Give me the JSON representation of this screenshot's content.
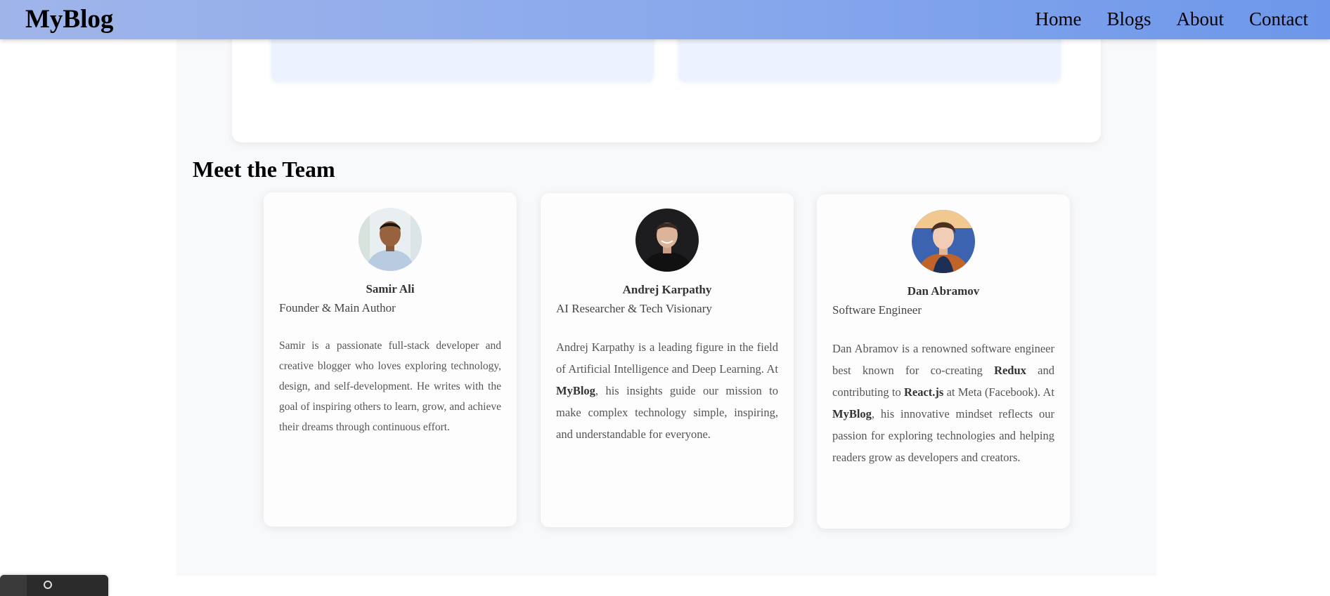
{
  "navbar": {
    "brand": "MyBlog",
    "links": [
      "Home",
      "Blogs",
      "About",
      "Contact"
    ],
    "gradient_start": "#9fb5ea",
    "gradient_end": "#6d97ea"
  },
  "team_section": {
    "title": "Meet the Team",
    "members": [
      {
        "name": "Samir Ali",
        "role": "Founder & Main Author",
        "avatar": "samir-ali-photo",
        "bio": "Samir is a passionate full-stack developer and creative blogger who loves exploring technology, design, and self-development. He writes with the goal of inspiring others to learn, grow, and achieve their dreams through continuous effort."
      },
      {
        "name": "Andrej Karpathy",
        "role": "AI Researcher & Tech Visionary",
        "avatar": "andrej-karpathy-photo",
        "bio_parts": [
          "Andrej Karpathy is a leading figure in the field of Artificial Intelligence and Deep Learning. At ",
          "MyBlog",
          ", his insights guide our mission to make complex technology simple, inspiring, and understandable for everyone."
        ]
      },
      {
        "name": "Dan Abramov",
        "role": "Software Engineer",
        "avatar": "dan-abramov-photo",
        "bio_parts": [
          "Dan Abramov is a renowned software engineer best known for co-creating ",
          "Redux",
          " and contributing to ",
          "React.js",
          " at Meta (Facebook). At ",
          "MyBlog",
          ", his innovative mindset reflects our passion for exploring technologies and helping readers grow as developers and creators."
        ]
      }
    ]
  },
  "colors": {
    "page_background": "#f8f9fb",
    "card_background": "#fdfdfd",
    "tile_background": "#edf3fe"
  }
}
